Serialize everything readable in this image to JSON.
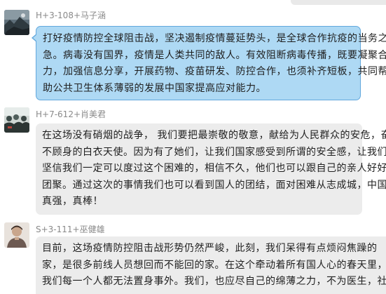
{
  "colors": {
    "selected_bubble_bg": "#aed9f4",
    "selected_bubble_border": "#62a8dd",
    "bubble_bg": "#ececec",
    "name_text": "#8a8a8a"
  },
  "messages": [
    {
      "sender": "H+3-108+马子涵",
      "avatar_icon": "user-avatar-photo-landscape",
      "selected": true,
      "lines": [
        "打好疫情防控全球阻击战，坚决遏制疫情蔓延势头，是全球合作抗疫的当务之",
        "急。病毒没有国界，疫情是人类共同的敌人。有效阻断病毒传播，既要凝聚合",
        "力，加强信息分享，开展药物、疫苗研发、防控合作，也须补齐短板，共同帮",
        "助公共卫生体系薄弱的发展中国家提高应对能力。"
      ]
    },
    {
      "sender": "H+7-612+肖美君",
      "avatar_icon": "user-avatar-photo-crowd",
      "selected": false,
      "lines": [
        "在这场没有硝烟的战争， 我们要把最崇敬的敬意，献给为人民群众的安危，奋",
        "不顾身的白衣天使。因为有了她们，让我们国家感受到所谓的安全感，让我们",
        "坚信我们一定可以度过这个困难的，相信不久，他们也可以跟自己的亲人好好",
        "团聚。通过这次的事情我们也可以看到国人的团结，面对困难从志成城，中国",
        "真强，真棒！"
      ]
    },
    {
      "sender": "S+3-111+巫健雄",
      "avatar_icon": "user-avatar-photo-portrait",
      "selected": false,
      "lines": [
        "目前，这场疫情防控阻击战形势仍然严峻，此刻，我们呆得有点烦闷焦躁的",
        "家，是很多前线人员想回而不能回的家。在这个牵动着所有国人心的春天里，",
        "我们每一个人都无法置身事外。我们，也应尽自己的绵薄之力，不为医生，社"
      ]
    }
  ]
}
